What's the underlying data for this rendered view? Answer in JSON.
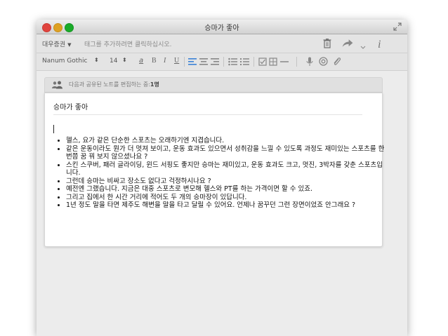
{
  "window": {
    "title": "승마가 좋아"
  },
  "tagbar": {
    "notebook": "대우증권",
    "tag_placeholder": "태그를 추가하려면 클릭하십시오."
  },
  "format": {
    "font": "Nanum Gothic",
    "size": "14",
    "buttons": {
      "color": "a",
      "bold": "B",
      "italic": "I",
      "underline": "U"
    }
  },
  "share": {
    "text": "다음과 공유된 노트를 편집하는 중:",
    "count": "1명"
  },
  "note": {
    "title": "승마가 좋아",
    "bullets": [
      "헬스, 요가 같은 단순한 스포츠는 오래하기엔 지겹습니다.",
      "같은 운동이라도 뭔가 더 멋져 보이고, 운동 효과도 있으면서 성취감을 느낄 수 있도록 과정도 재미있는 스포츠를 한 번쯤 꿈 꿔 보지 않으셨나요 ?",
      "스킨 스쿠버, 패러 글라이딩, 윈드 서핑도 좋지만 승마는 재미있고, 운동 효과도 크고, 멋진, 3박자를 갖춘 스포츠입니다.",
      "그런데 승마는 비싸고 장소도 없다고 걱정하시나요 ?",
      "예전엔 그랬습니다. 지금은 대중 스포츠로 변모해 헬스와 PT를 하는 가격이면 할 수 있죠.",
      "그리고 집에서 한 시간 거리에 적어도 두 개의 승마장이 있답니다.",
      "1년 정도 말을 타면 제주도 해변을 말을 타고 달릴 수 있어요. 언제나 꿈꾸던 그런 장면이었죠 안그래요 ?"
    ]
  }
}
